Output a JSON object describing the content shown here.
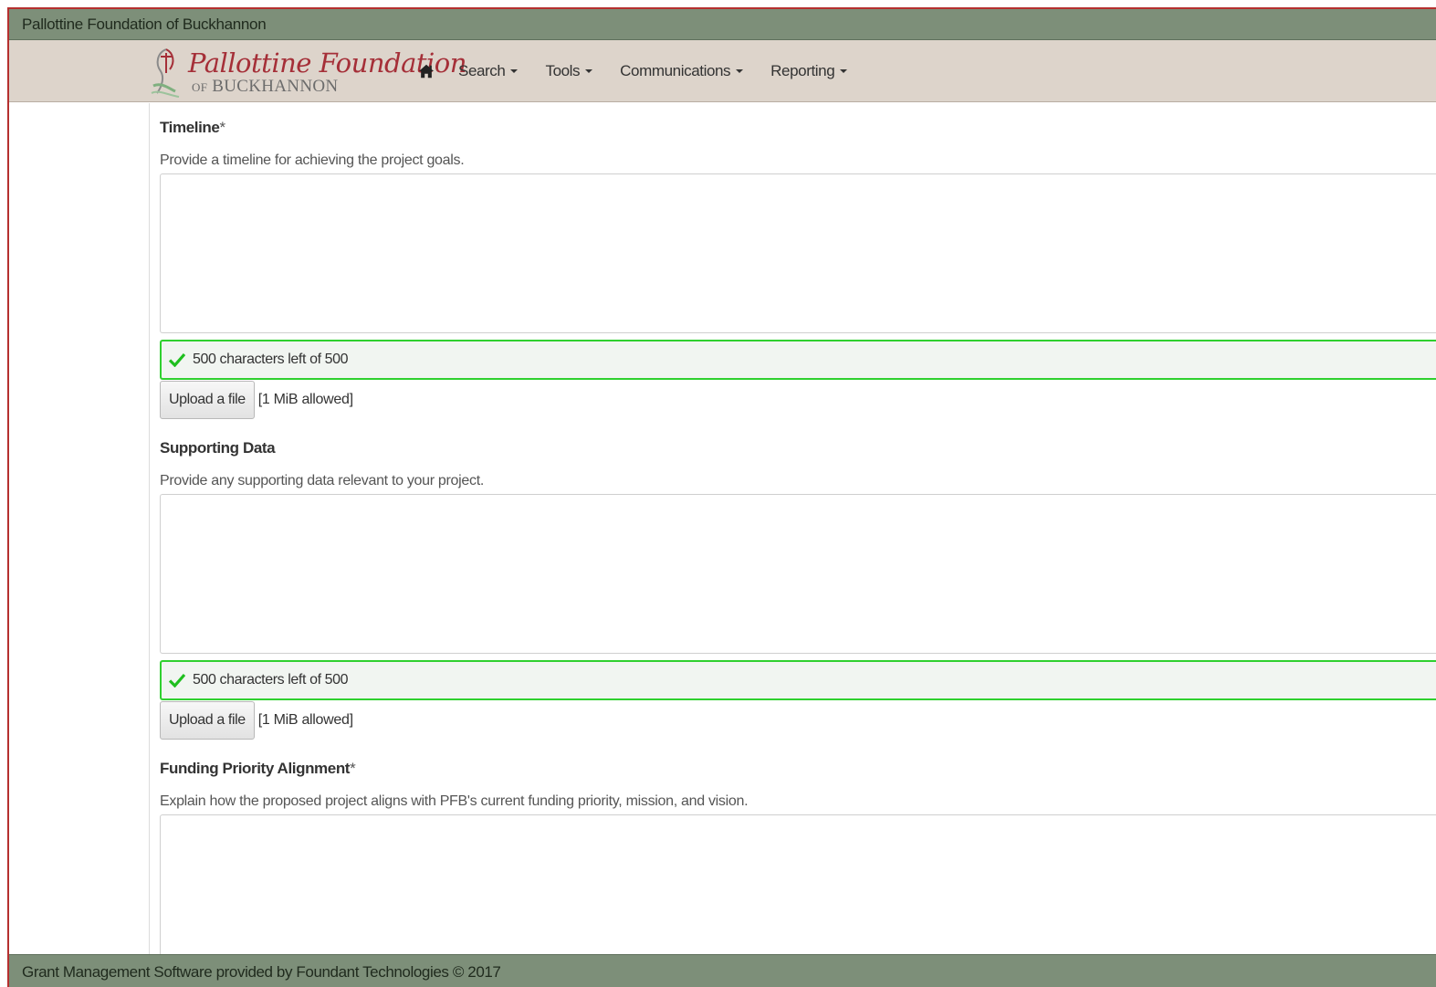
{
  "top_bar": {
    "title": "Pallottine Foundation of Buckhannon"
  },
  "logo": {
    "main": "Pallottine Foundation",
    "sub_prefix": "OF",
    "sub": "BUCKHANNON"
  },
  "nav": {
    "home_icon": "home-icon",
    "items": [
      {
        "label": "Search"
      },
      {
        "label": "Tools"
      },
      {
        "label": "Communications"
      },
      {
        "label": "Reporting"
      }
    ]
  },
  "form": {
    "timeline": {
      "label": "Timeline",
      "required_mark": "*",
      "help": "Provide a timeline for achieving the project goals.",
      "value": "",
      "counter": "500 characters left of 500",
      "upload_label": "Upload a file",
      "upload_note": "[1 MiB allowed]"
    },
    "supporting_data": {
      "label": "Supporting Data",
      "help": "Provide any supporting data relevant to your project.",
      "value": "",
      "counter": "500 characters left of 500",
      "upload_label": "Upload a file",
      "upload_note": "[1 MiB allowed]"
    },
    "funding_priority": {
      "label": "Funding Priority Alignment",
      "required_mark": "*",
      "help": "Explain how the proposed project aligns with PFB's current funding priority, mission, and vision.",
      "value": ""
    }
  },
  "footer": {
    "text": "Grant Management Software provided by Foundant Technologies © 2017"
  },
  "colors": {
    "bar_green": "#7d8f79",
    "nav_beige": "#ddd4cb",
    "logo_red": "#a52f38",
    "valid_green": "#2fd02f",
    "frame_red": "#b5302f"
  }
}
